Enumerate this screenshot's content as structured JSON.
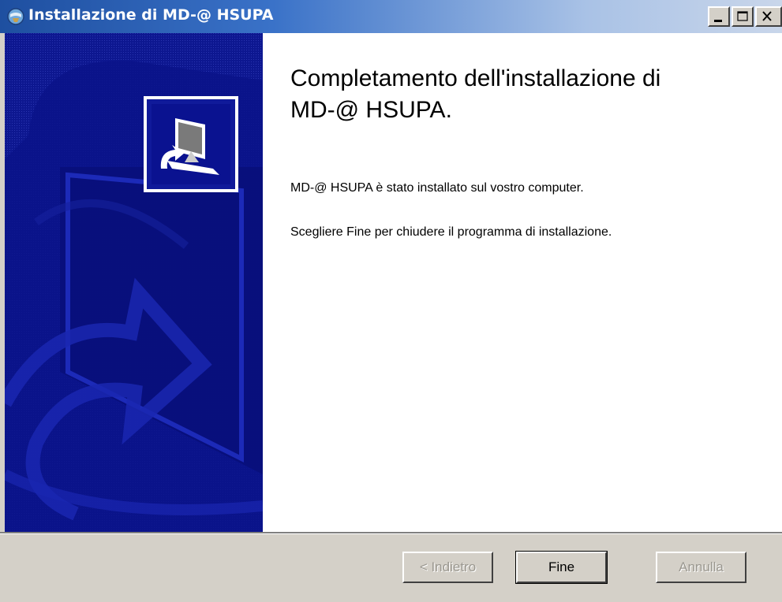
{
  "window": {
    "title": "Installazione di MD-@ HSUPA",
    "controls": {
      "minimize": "minimize",
      "maximize": "maximize",
      "close": "close"
    }
  },
  "content": {
    "heading_line1": "Completamento dell'installazione di",
    "heading_line2": "MD-@ HSUPA.",
    "message1": "MD-@ HSUPA è stato installato sul vostro computer.",
    "message2": "Scegliere Fine per chiudere il programma di installazione."
  },
  "buttons": {
    "back": "< Indietro",
    "finish": "Fine",
    "cancel": "Annulla"
  },
  "colors": {
    "sidebar": "#101a9a",
    "titlebar_start": "#1e4fa0",
    "dialog_bg": "#d4d0c8"
  },
  "icons": {
    "title": "setup-globe-icon",
    "logo": "installer-computer-icon"
  }
}
